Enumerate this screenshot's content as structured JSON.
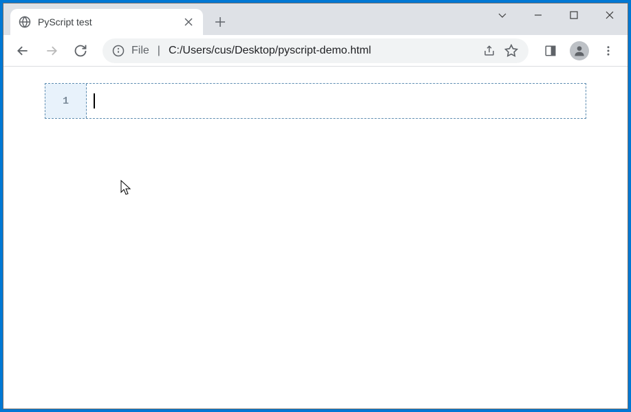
{
  "tab": {
    "title": "PyScript test"
  },
  "address": {
    "prefix": "File",
    "url": "C:/Users/cus/Desktop/pyscript-demo.html"
  },
  "editor": {
    "line_number": "1",
    "code_content": ""
  }
}
